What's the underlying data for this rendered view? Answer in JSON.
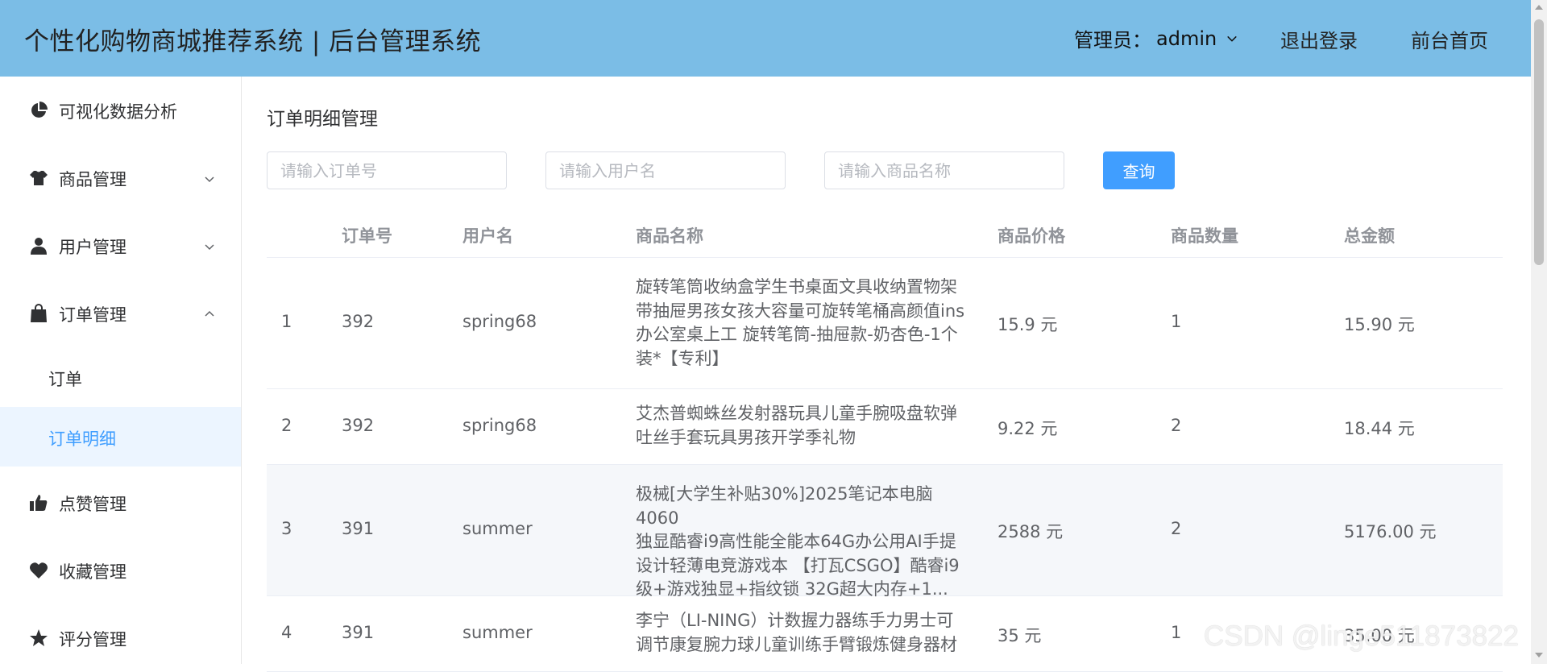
{
  "header": {
    "title": "个性化购物商城推荐系统 | 后台管理系统",
    "admin_label": "管理员：",
    "admin_name": "admin",
    "logout": "退出登录",
    "frontpage": "前台首页"
  },
  "sidebar": {
    "items": [
      {
        "label": "可视化数据分析",
        "icon": "pie-chart-icon"
      },
      {
        "label": "商品管理",
        "icon": "tshirt-icon",
        "expandable": true,
        "expanded": false
      },
      {
        "label": "用户管理",
        "icon": "user-icon",
        "expandable": true,
        "expanded": false
      },
      {
        "label": "订单管理",
        "icon": "shopping-bag-icon",
        "expandable": true,
        "expanded": true
      },
      {
        "label": "点赞管理",
        "icon": "thumbs-up-icon"
      },
      {
        "label": "收藏管理",
        "icon": "heart-icon"
      },
      {
        "label": "评分管理",
        "icon": "star-icon"
      }
    ],
    "sub_items": [
      {
        "label": "订单",
        "active": false
      },
      {
        "label": "订单明细",
        "active": true
      }
    ],
    "active_color": "#409eff"
  },
  "main": {
    "title": "订单明细管理",
    "search": {
      "order_placeholder": "请输入订单号",
      "user_placeholder": "请输入用户名",
      "product_placeholder": "请输入商品名称",
      "button": "查询"
    },
    "table": {
      "columns": [
        "",
        "订单号",
        "用户名",
        "商品名称",
        "商品价格",
        "商品数量",
        "总金额"
      ],
      "rows": [
        {
          "index": "1",
          "order_id": "392",
          "username": "spring68",
          "product_lines": [
            "旋转笔筒收纳盒学生书桌面文具收纳置物架",
            "带抽屉男孩女孩大容量可旋转笔桶高颜值ins",
            "办公室桌上工 旋转笔筒-抽屉款-奶杏色-1个",
            "装*【专利】"
          ],
          "price": "15.9 元",
          "quantity": "1",
          "total": "15.90 元"
        },
        {
          "index": "2",
          "order_id": "392",
          "username": "spring68",
          "product_lines": [
            "艾杰普蜘蛛丝发射器玩具儿童手腕吸盘软弹",
            "吐丝手套玩具男孩开学季礼物"
          ],
          "price": "9.22 元",
          "quantity": "2",
          "total": "18.44 元"
        },
        {
          "index": "3",
          "order_id": "391",
          "username": "summer",
          "product_lines": [
            "极械[大学生补贴30%]2025笔记本电脑4060",
            "独显酷睿i9高性能全能本64G办公用AI手提",
            "设计轻薄电竞游戏本 【打瓦CSGO】酷睿i9",
            "级+游戏独显+指纹锁 32G超大内存+1..."
          ],
          "price": "2588 元",
          "quantity": "2",
          "total": "5176.00 元"
        },
        {
          "index": "4",
          "order_id": "391",
          "username": "summer",
          "product_lines": [
            "李宁（LI-NING）计数握力器练手力男士可",
            "调节康复腕力球儿童训练手臂锻炼健身器材"
          ],
          "price": "35 元",
          "quantity": "1",
          "total": "35.00 元"
        }
      ]
    }
  },
  "watermark": "CSDN @linge511873822",
  "colors": {
    "header_bg": "#7bbde6",
    "primary": "#409eff"
  }
}
